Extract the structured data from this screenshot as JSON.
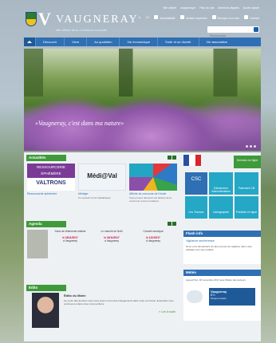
{
  "header": {
    "title": "VAUGNERAY",
    "subtitle": "site officiel de la Commune nouvelle",
    "toplinks": [
      "Site officiel",
      "vaugneray.fr",
      "Plan du site",
      "Mentions légales",
      "Accès rapide"
    ],
    "tools": [
      "A-",
      "A+",
      "Accessibilité",
      "Version imprimée",
      "Envoyer à un ami",
      "Contact"
    ],
    "search_placeholder": "Rechercher"
  },
  "nav": {
    "items": [
      "Découvrir",
      "Vivre",
      "Au quotidien",
      "Vie économique",
      "Sortir et se divertir",
      "Vie associative"
    ]
  },
  "hero": {
    "caption": "«Vaugneray, c'est dans ma nature»"
  },
  "actualites": {
    "title": "Actualités",
    "cards": [
      {
        "title": "Ressourcerie éphémère",
        "desc": "",
        "img_line1": "RESSOURCERIE",
        "img_line2": "ÉPHÉMÈRE",
        "img_brand": "VALTRONS"
      },
      {
        "title": "Médiger",
        "desc": "Ce samedi 4 à la médiathèque",
        "img_label": "Médi@Val"
      },
      {
        "title": "Affiche du concours de l'école",
        "desc": "Vous pouvez découvrir les artistes de la commune et leurs créations.",
        "img_label": ""
      }
    ]
  },
  "agenda": {
    "title": "Agenda",
    "events": [
      {
        "name": "Dons de vêtements enfants",
        "date": "le 16/11/2017",
        "place": "à Vaugneray"
      },
      {
        "name": "Le marché de Noël",
        "date": "le 16/11/2017",
        "place": "à Vaugneray"
      },
      {
        "name": "Conseil municipal",
        "date": "le 11/1/2017",
        "place": "à Vaugneray"
      }
    ]
  },
  "edito": {
    "title": "Édito",
    "heading": "Édito du Maire",
    "text": "Ce cours des derniers mois nous avons connu des changements dans notre commune. Ensemble nous continuons à faire vivre notre territoire.",
    "link": "» Lire la suite"
  },
  "right": {
    "flag_label": "",
    "services_title": "Services en ligne",
    "tiles": [
      "Espace CSC",
      "Démarches Administratives",
      "Paiement CB",
      "Les Travaux",
      "Cartographie",
      "Publicité en ligne"
    ],
    "tile_big": "CSC",
    "flash_title": "Flash info",
    "flash_heading": "Vigilance sécheresse",
    "flash_text": "Nous vous demandons de faire preuve de vigilance dans votre utilisation de l'eau potable.",
    "meteo_title": "Météo",
    "meteo_text": "Aujourd'hui, 18 novembre 2017 avec Météo des lecteurs",
    "meteo_city": "Vaugneray",
    "meteo_temp": "8°C",
    "meteo_cond": "Temps couvert"
  }
}
